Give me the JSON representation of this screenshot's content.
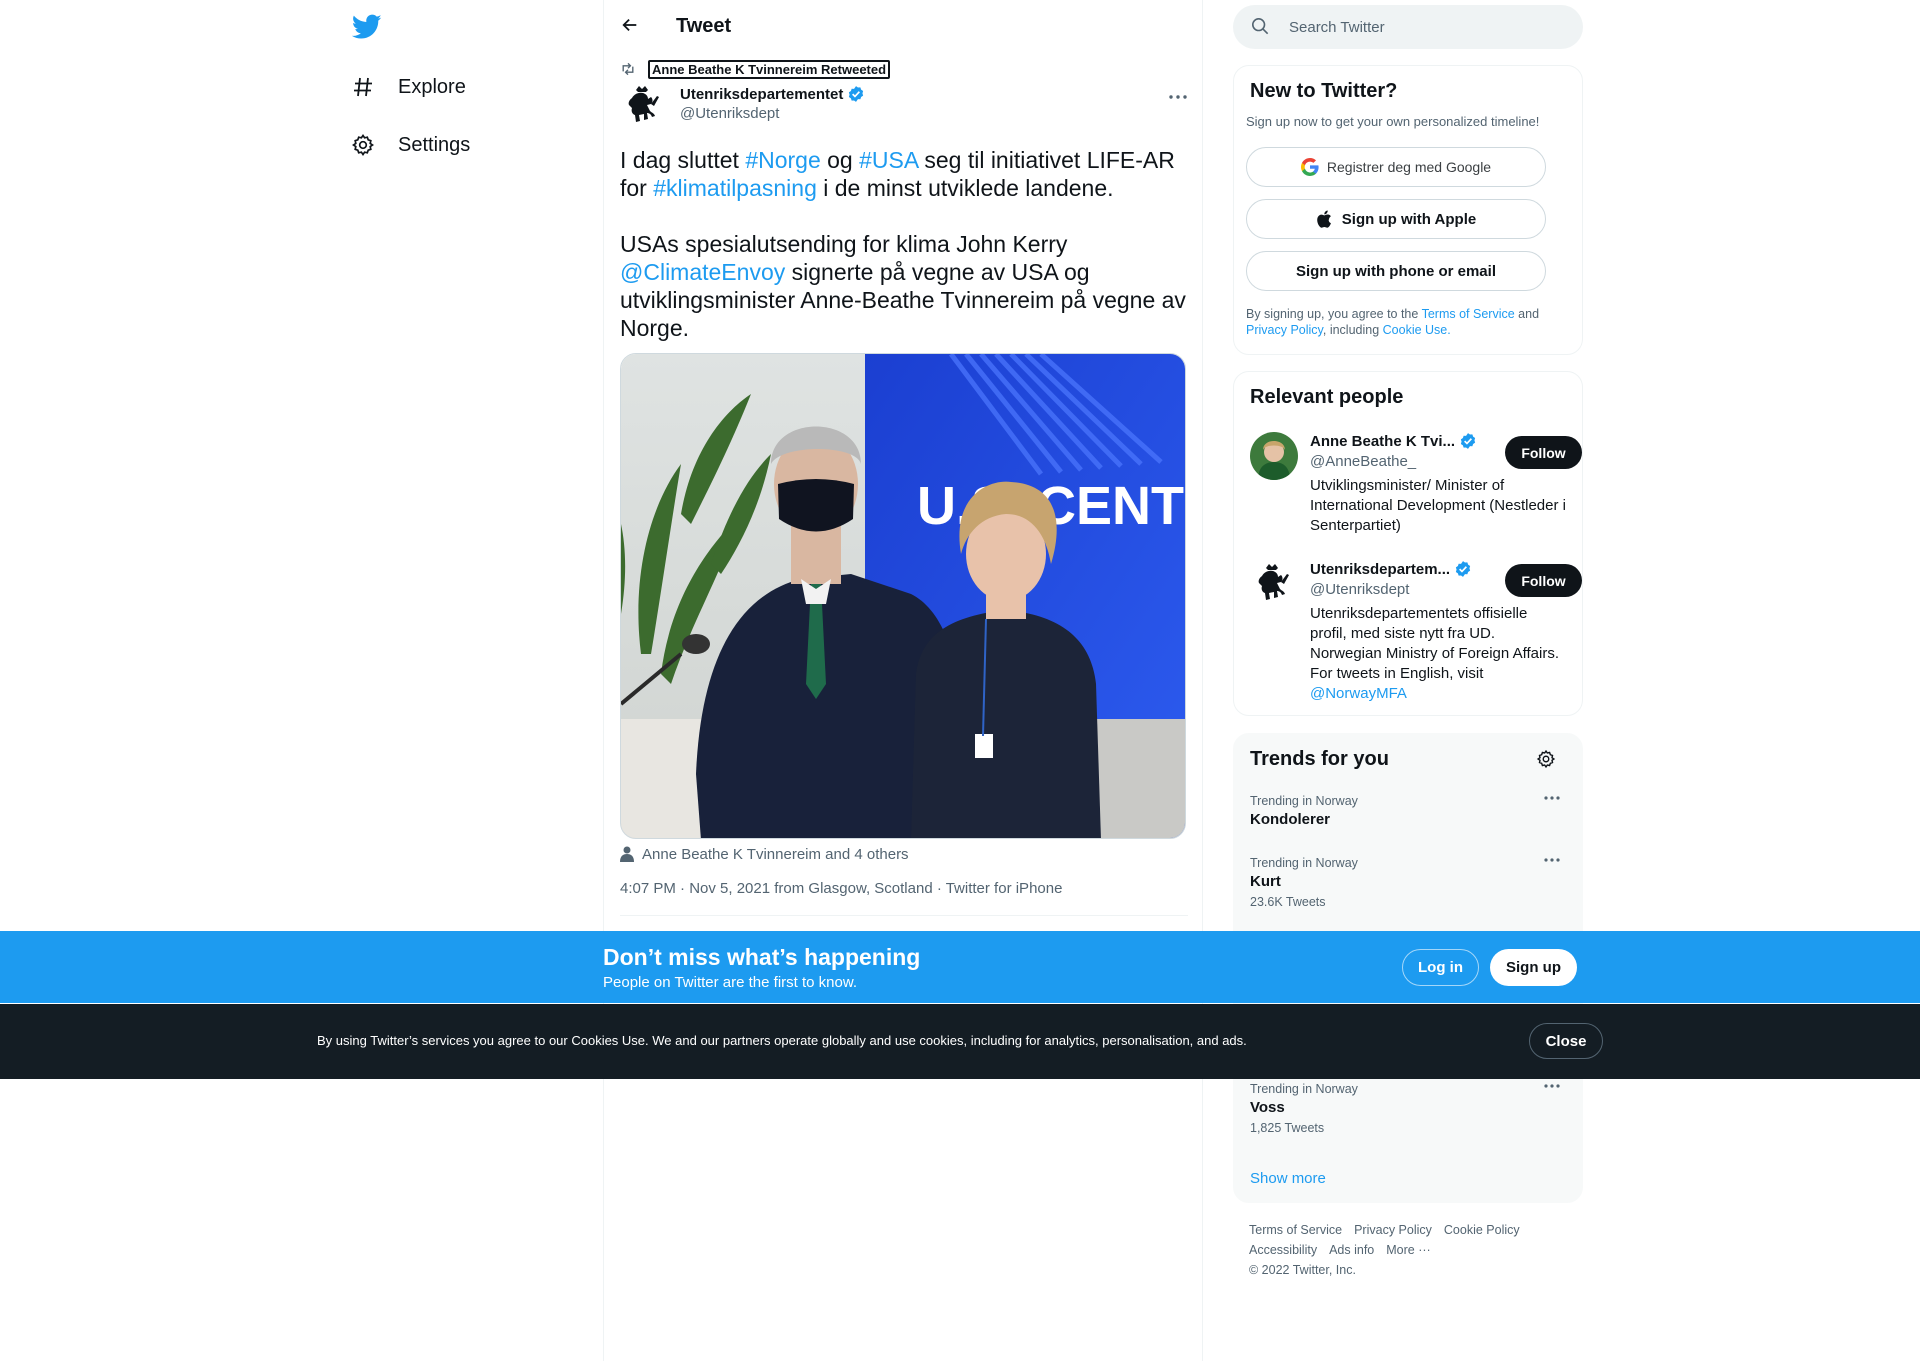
{
  "nav": {
    "logo": "twitter-bird-icon",
    "items": [
      {
        "label": "Explore",
        "icon": "hashtag-icon"
      },
      {
        "label": "Settings",
        "icon": "gear-icon"
      }
    ]
  },
  "header": {
    "title": "Tweet"
  },
  "tweet": {
    "retweeted_by": "Anne Beathe K Tvinnereim Retweeted",
    "author_name": "Utenriksdepartementet",
    "author_handle": "@Utenriksdept",
    "text": {
      "p1_a": "I dag sluttet ",
      "p1_tag1": "#Norge",
      "p1_b": " og ",
      "p1_tag2": "#USA",
      "p1_c": " seg til initiativet LIFE-AR for ",
      "p1_tag3": "#klimatilpasning",
      "p1_d": " i de minst utviklede landene.",
      "p2_a": "USAs spesialutsending for klima John Kerry ",
      "p2_mention": "@ClimateEnvoy",
      "p2_b": " signerte på vegne av USA og utviklingsminister Anne-Beathe Tvinnereim på vegne av Norge."
    },
    "media_sign_text": "U.S. CENT",
    "tagged": "Anne Beathe K Tvinnereim and 4 others",
    "timestamp": "4:07 PM · Nov 5, 2021 from Glasgow, Scotland · Twitter for iPhone"
  },
  "search": {
    "placeholder": "Search Twitter"
  },
  "new_to_twitter": {
    "title": "New to Twitter?",
    "subtitle": "Sign up now to get your own personalized timeline!",
    "google_label": "Registrer deg med Google",
    "apple_label": "Sign up with Apple",
    "phone_label": "Sign up with phone or email",
    "legal_a": "By signing up, you agree to the ",
    "legal_tos": "Terms of Service",
    "legal_b": " and ",
    "legal_privacy": "Privacy Policy",
    "legal_c": ", including ",
    "legal_cookie": "Cookie Use."
  },
  "relevant_people": {
    "title": "Relevant people",
    "people": [
      {
        "name": "Anne Beathe K Tvi...",
        "handle": "@AnneBeathe_",
        "bio": "Utviklingsminister/ Minister of International Development (Nestleder i Senterpartiet)",
        "follow_label": "Follow"
      },
      {
        "name": "Utenriksdepartem...",
        "handle": "@Utenriksdept",
        "bio": "Utenriksdepartementets offisielle profil, med siste nytt fra UD. Norwegian Ministry of Foreign Affairs. For tweets in English, visit ",
        "bio_link": "@NorwayMFA",
        "follow_label": "Follow"
      }
    ]
  },
  "trends": {
    "title": "Trends for you",
    "items": [
      {
        "context": "Trending in Norway",
        "name": "Kondolerer",
        "count": ""
      },
      {
        "context": "Trending in Norway",
        "name": "Kurt",
        "count": "23.6K Tweets"
      },
      {
        "context": "Trending in Norway",
        "name": "Voss",
        "count": "1,825 Tweets"
      }
    ],
    "show_more": "Show more"
  },
  "footer": {
    "links": [
      "Terms of Service",
      "Privacy Policy",
      "Cookie Policy",
      "Accessibility",
      "Ads info",
      "More ···"
    ],
    "copyright": "© 2022 Twitter, Inc."
  },
  "banner": {
    "title": "Don’t miss what’s happening",
    "subtitle": "People on Twitter are the first to know.",
    "login_label": "Log in",
    "signup_label": "Sign up"
  },
  "cookie": {
    "text": "By using Twitter’s services you agree to our Cookies Use. We and our partners operate globally and use cookies, including for analytics, personalisation, and ads.",
    "close_label": "Close"
  },
  "colors": {
    "accent": "#1d9bf0",
    "text": "#0f1419",
    "muted": "#536471",
    "cookie_bg": "#141d24"
  }
}
